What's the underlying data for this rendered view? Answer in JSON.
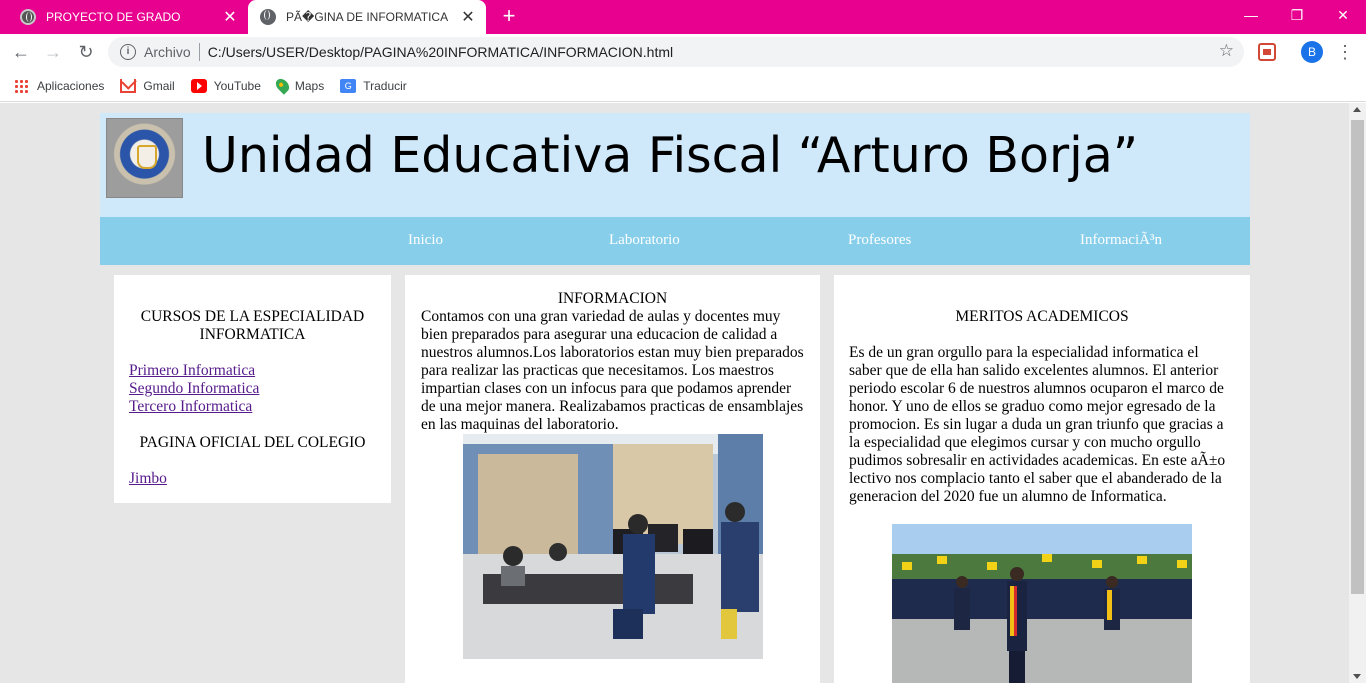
{
  "browser": {
    "tabs": [
      {
        "title": "PROYECTO DE GRADO",
        "active": false
      },
      {
        "title": "PÃ�GINA DE INFORMATICA",
        "active": true
      }
    ],
    "new_tab_icon": "plus-icon",
    "address": {
      "scheme": "Archivo",
      "url": "C:/Users/USER/Desktop/PAGINA%20INFORMATICA/INFORMACION.html"
    },
    "profile_initial": "B",
    "bookmarks": [
      "Aplicaciones",
      "Gmail",
      "YouTube",
      "Maps",
      "Traducir"
    ],
    "accent_color": "#e8008f"
  },
  "site": {
    "title": "Unidad Educativa Fiscal “Arturo Borja”",
    "nav": [
      "Inicio",
      "Laboratorio",
      "Profesores",
      "InformaciÃ³n"
    ]
  },
  "left": {
    "heading": "CURSOS DE LA ESPECIALIDAD INFORMATICA",
    "links": [
      "Primero Informatica",
      "Segundo Informatica",
      "Tercero Informatica"
    ],
    "heading2": "PAGINA OFICIAL DEL COLEGIO",
    "link2": "Jimbo"
  },
  "center": {
    "heading": "INFORMACION",
    "text": "Contamos con una gran variedad de aulas y docentes muy bien preparados para asegurar una educacion de calidad a nuestros alumnos.Los laboratorios estan muy bien preparados para realizar las practicas que necesitamos. Los maestros impartian clases con un infocus para que podamos aprender de una mejor manera. Realizabamos practicas de ensamblajes en las maquinas del laboratorio."
  },
  "right": {
    "heading": "MERITOS ACADEMICOS",
    "text": "Es de un gran orgullo para la especialidad informatica el saber que de ella han salido excelentes alumnos. El anterior periodo escolar 6 de nuestros alumnos ocuparon el marco de honor. Y uno de ellos se graduo como mejor egresado de la promocion. Es sin lugar a duda un gran triunfo que gracias a la especialidad que elegimos cursar y con mucho orgullo pudimos sobresalir en actividades academicas. En este aÃ±o lectivo nos complacio tanto el saber que el abanderado de la generacion del 2020 fue un alumno de Informatica."
  }
}
